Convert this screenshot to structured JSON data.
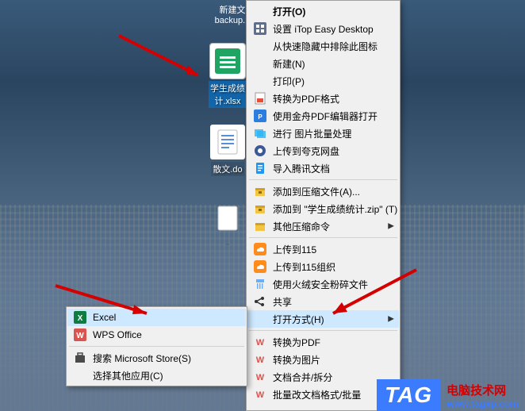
{
  "desktop": {
    "file_txt1": "新建文",
    "file_backup": "backup.p",
    "file_xls": "学生成绩\n计.xlsx",
    "file_doc": "散文.do",
    "file_blank": ""
  },
  "main_menu": {
    "open": "打开(O)",
    "itop": "设置 iTop Easy Desktop",
    "quickhide": "从快速隐藏中排除此图标",
    "new": "新建(N)",
    "print": "打印(P)",
    "to_pdf": "转换为PDF格式",
    "jinzhou": "使用金舟PDF编辑器打开",
    "batch_img": "进行 图片批量处理",
    "quark": "上传到夸克网盘",
    "tencent": "导入腾讯文档",
    "compress_a": "添加到压缩文件(A)...",
    "compress_t": "添加到 \"学生成绩统计.zip\" (T)",
    "compress_other": "其他压缩命令",
    "up115": "上传到115",
    "up115org": "上传到115组织",
    "huorong": "使用火绒安全粉碎文件",
    "share": "共享",
    "open_with": "打开方式(H)",
    "w_pdf": "转换为PDF",
    "w_img": "转换为图片",
    "w_merge": "文档合并/拆分",
    "w_batch": "批量改文档格式/批量"
  },
  "sub_menu": {
    "excel": "Excel",
    "wps": "WPS Office",
    "store": "搜索 Microsoft Store(S)",
    "other": "选择其他应用(C)"
  },
  "watermark": {
    "tag": "TAG",
    "cn": "电脑技术网",
    "url": "www.tagxp.com"
  }
}
